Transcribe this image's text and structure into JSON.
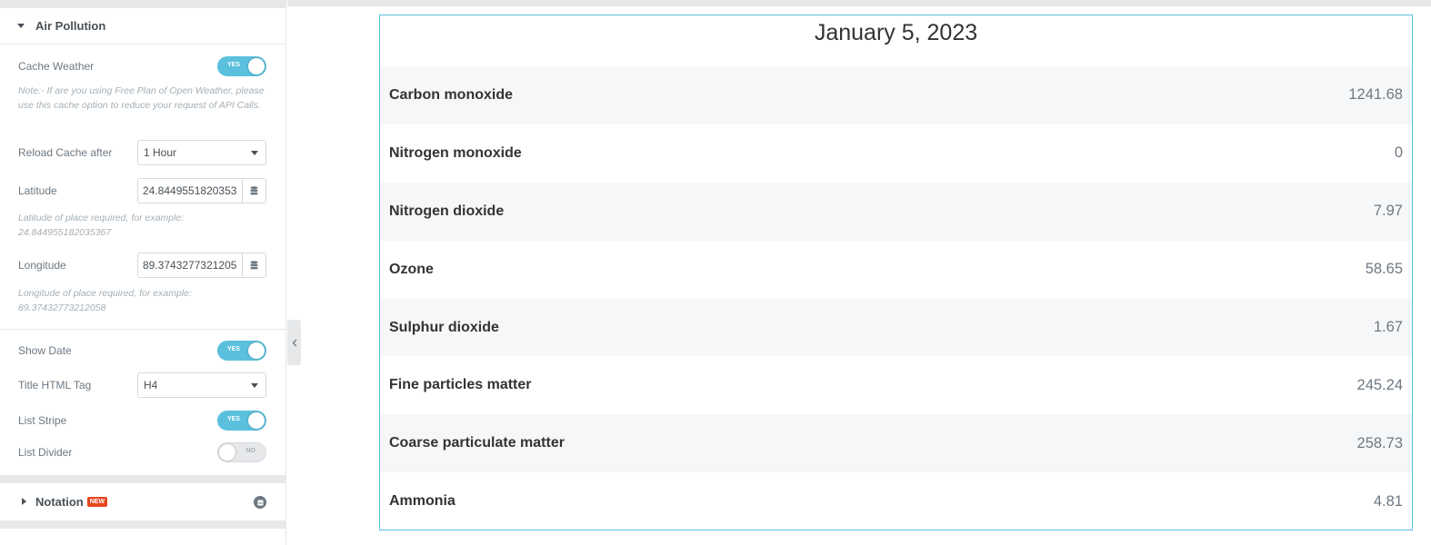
{
  "panel": {
    "section_title": "Air Pollution",
    "cache_weather_label": "Cache Weather",
    "cache_weather_toggle": "YES",
    "cache_note": "Note:- If are you using Free Plan of Open Weather, please use this cache option to reduce your request of API Calls.",
    "reload_cache_label": "Reload Cache after",
    "reload_cache_value": "1 Hour",
    "latitude_label": "Latitude",
    "latitude_value": "24.8449551820353",
    "latitude_note": "Latitude of place required, for example: 24.844955182035367",
    "longitude_label": "Longitude",
    "longitude_value": "89.3743277321205",
    "longitude_note": "Longitude of place required, for example: 89.37432773212058",
    "show_date_label": "Show Date",
    "show_date_toggle": "YES",
    "title_tag_label": "Title HTML Tag",
    "title_tag_value": "H4",
    "list_stripe_label": "List Stripe",
    "list_stripe_toggle": "YES",
    "list_divider_label": "List Divider",
    "list_divider_toggle": "NO",
    "notation_title": "Notation",
    "new_badge": "NEW"
  },
  "preview": {
    "date": "January 5, 2023",
    "rows": [
      {
        "label": "Carbon monoxide",
        "value": "1241.68"
      },
      {
        "label": "Nitrogen monoxide",
        "value": "0"
      },
      {
        "label": "Nitrogen dioxide",
        "value": "7.97"
      },
      {
        "label": "Ozone",
        "value": "58.65"
      },
      {
        "label": "Sulphur dioxide",
        "value": "1.67"
      },
      {
        "label": "Fine particles matter",
        "value": "245.24"
      },
      {
        "label": "Coarse particulate matter",
        "value": "258.73"
      },
      {
        "label": "Ammonia",
        "value": "4.81"
      }
    ]
  },
  "colors": {
    "accent": "#5bc0de",
    "badge": "#e8461e",
    "stripe": "#f6f7f8"
  }
}
